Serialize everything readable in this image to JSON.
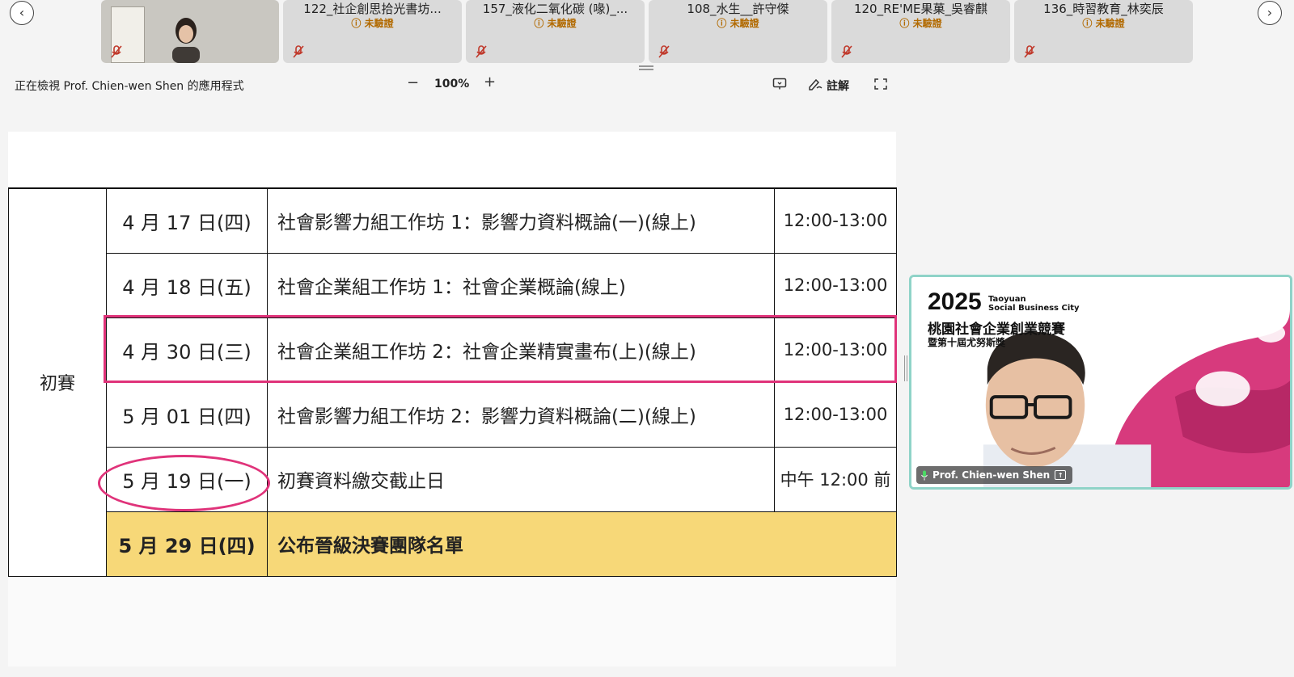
{
  "gallery": {
    "prev_icon": "chevron-left-icon",
    "next_icon": "chevron-right-icon",
    "participants": [
      {
        "name": "",
        "badge": ""
      },
      {
        "name": "122_社企創思拾光書坊...",
        "badge": "未驗證"
      },
      {
        "name": "157_液化二氧化碳 (喙)_...",
        "badge": "未驗證"
      },
      {
        "name": "108_水生__許守傑",
        "badge": "未驗證"
      },
      {
        "name": "120_RE'ME果菓_吳睿麒",
        "badge": "未驗證"
      },
      {
        "name": "136_時習教育_林奕辰",
        "badge": "未驗證"
      }
    ]
  },
  "toolbar": {
    "viewing": "正在檢視 Prof. Chien-wen Shen 的應用程式",
    "zoom_out": "−",
    "zoom": "100%",
    "zoom_in": "+",
    "annotate": "註解"
  },
  "schedule": {
    "stage": "初賽",
    "rows": [
      {
        "date": "4 月 17 日(四)",
        "event": "社會影響力組工作坊 1：影響力資料概論(一)(線上)",
        "time": "12:00-13:00"
      },
      {
        "date": "4 月 18 日(五)",
        "event": "社會企業組工作坊 1：社會企業概論(線上)",
        "time": "12:00-13:00"
      },
      {
        "date": "4 月 30 日(三)",
        "event": "社會企業組工作坊 2：社會企業精實畫布(上)(線上)",
        "time": "12:00-13:00"
      },
      {
        "date": "5 月 01 日(四)",
        "event": "社會影響力組工作坊 2：影響力資料概論(二)(線上)",
        "time": "12:00-13:00"
      },
      {
        "date": "5 月 19 日(一)",
        "event": "初賽資料繳交截止日",
        "time": "中午 12:00 前"
      },
      {
        "date": "5 月 29 日(四)",
        "event": "公布晉級決賽團隊名單",
        "time": ""
      }
    ]
  },
  "speaker": {
    "name": "Prof. Chien-wen Shen",
    "banner_year": "2025",
    "banner_city_1": "Taoyuan",
    "banner_city_2": "Social Business City",
    "banner_title": "桃園社會企業創業競賽",
    "banner_sub": "暨第十屆尤努斯獎"
  },
  "colors": {
    "annotation": "#e0337a",
    "highlight_row": "#f7d878",
    "speaker_border": "#8fd3c8",
    "unverified_badge": "#b26a00"
  }
}
